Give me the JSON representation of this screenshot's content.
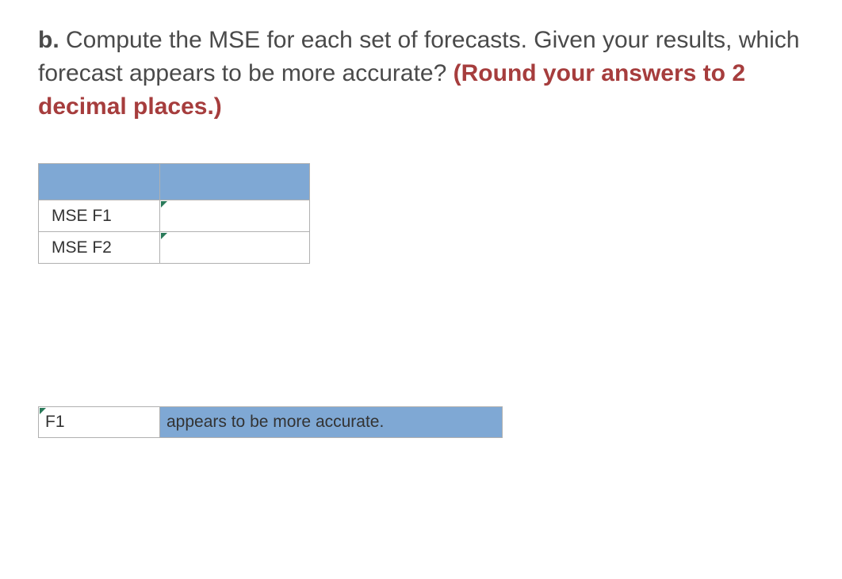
{
  "question": {
    "label": "b.",
    "text": "Compute the MSE for each set of forecasts. Given your results, which forecast appears to be more accurate?",
    "instruction": "(Round your answers to 2 decimal places.)"
  },
  "table": {
    "rows": [
      {
        "label": "MSE F1",
        "value": ""
      },
      {
        "label": "MSE F2",
        "value": ""
      }
    ]
  },
  "answer": {
    "value": "F1",
    "text": "appears to be more accurate."
  }
}
